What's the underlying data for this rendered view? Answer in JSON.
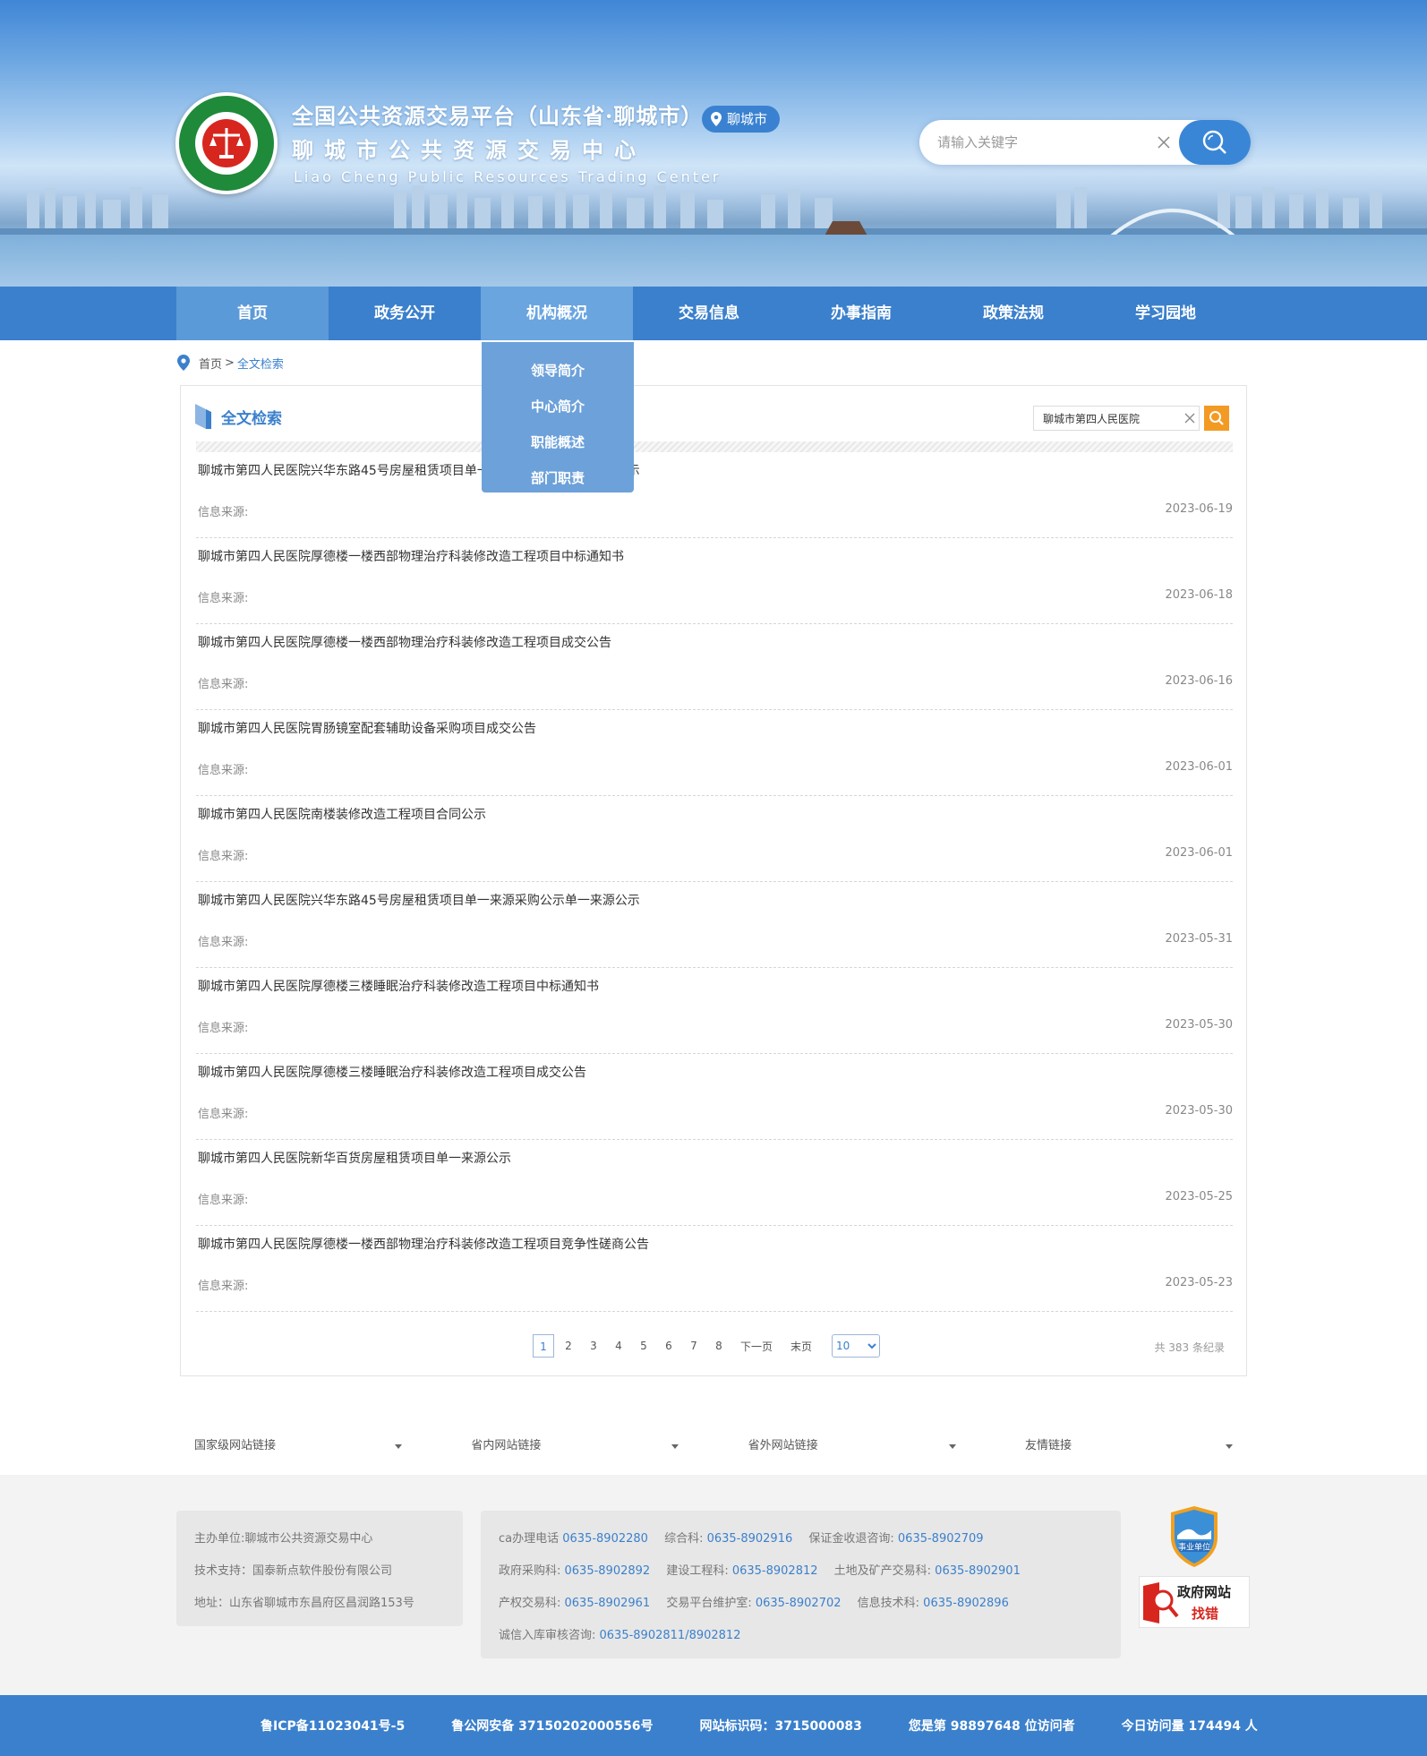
{
  "header": {
    "title_line1": "全国公共资源交易平台（山东省·聊城市）",
    "title_line2": "聊城市公共资源交易中心",
    "title_line3": "Liao Cheng Public Resources Trading Center",
    "city_badge": "聊城市",
    "search_placeholder": "请输入关键字"
  },
  "nav": {
    "items": [
      {
        "label": "首页"
      },
      {
        "label": "政务公开"
      },
      {
        "label": "机构概况"
      },
      {
        "label": "交易信息"
      },
      {
        "label": "办事指南"
      },
      {
        "label": "政策法规"
      },
      {
        "label": "学习园地"
      }
    ],
    "dropdown": [
      "领导简介",
      "中心简介",
      "职能概述",
      "部门职责"
    ]
  },
  "breadcrumb": {
    "home": "首页",
    "separator": ">",
    "current": "全文检索"
  },
  "main": {
    "title": "全文检索",
    "search_value": "聊城市第四人民医院",
    "results": [
      {
        "title": "聊城市第四人民医院兴华东路45号房屋租赁项目单一来源采购公示单一来源公示",
        "source": "信息来源:",
        "date": "2023-06-19"
      },
      {
        "title": "聊城市第四人民医院厚德楼一楼西部物理治疗科装修改造工程项目中标通知书",
        "source": "信息来源:",
        "date": "2023-06-18"
      },
      {
        "title": "聊城市第四人民医院厚德楼一楼西部物理治疗科装修改造工程项目成交公告",
        "source": "信息来源:",
        "date": "2023-06-16"
      },
      {
        "title": "聊城市第四人民医院胃肠镜室配套辅助设备采购项目成交公告",
        "source": "信息来源:",
        "date": "2023-06-01"
      },
      {
        "title": "聊城市第四人民医院南楼装修改造工程项目合同公示",
        "source": "信息来源:",
        "date": "2023-06-01"
      },
      {
        "title": "聊城市第四人民医院兴华东路45号房屋租赁项目单一来源采购公示单一来源公示",
        "source": "信息来源:",
        "date": "2023-05-31"
      },
      {
        "title": "聊城市第四人民医院厚德楼三楼睡眠治疗科装修改造工程项目中标通知书",
        "source": "信息来源:",
        "date": "2023-05-30"
      },
      {
        "title": "聊城市第四人民医院厚德楼三楼睡眠治疗科装修改造工程项目成交公告",
        "source": "信息来源:",
        "date": "2023-05-30"
      },
      {
        "title": "聊城市第四人民医院新华百货房屋租赁项目单一来源公示",
        "source": "信息来源:",
        "date": "2023-05-25"
      },
      {
        "title": "聊城市第四人民医院厚德楼一楼西部物理治疗科装修改造工程项目竞争性磋商公告",
        "source": "信息来源:",
        "date": "2023-05-23"
      }
    ],
    "pager": {
      "pages": [
        "1",
        "2",
        "3",
        "4",
        "5",
        "6",
        "7",
        "8"
      ],
      "current_page": "1",
      "next": "下一页",
      "last": "末页",
      "page_size": "10",
      "total": "共 383 条纪录"
    }
  },
  "links": [
    "国家级网站链接",
    "省内网站链接",
    "省外网站链接",
    "友情链接"
  ],
  "footer": {
    "left_lines": [
      "主办单位:聊城市公共资源交易中心",
      "技术支持：国泰新点软件股份有限公司",
      "地址：山东省聊城市东昌府区昌润路153号"
    ],
    "contacts": [
      [
        {
          "label": "ca办理电话 ",
          "number": "0635-8902280"
        },
        {
          "label": "综合科: ",
          "number": "0635-8902916"
        },
        {
          "label": "保证金收退咨询: ",
          "number": "0635-8902709"
        }
      ],
      [
        {
          "label": "政府采购科: ",
          "number": "0635-8902892"
        },
        {
          "label": "建设工程科: ",
          "number": "0635-8902812"
        },
        {
          "label": "土地及矿产交易科: ",
          "number": "0635-8902901"
        }
      ],
      [
        {
          "label": "产权交易科: ",
          "number": "0635-8902961"
        },
        {
          "label": "交易平台维护室: ",
          "number": "0635-8902702"
        },
        {
          "label": "信息技术科: ",
          "number": "0635-8902896"
        }
      ],
      [
        {
          "label": "诚信入库审核咨询: ",
          "number": "0635-8902811/8902812"
        }
      ]
    ],
    "badge_text": "事业单位",
    "zhaocuo_line1": "政府网站",
    "zhaocuo_line2": "找错"
  },
  "bottom": {
    "icp": "鲁ICP备11023041号-5",
    "police": "鲁公网安备 37150202000556号",
    "site_id": "网站标识码：3715000083",
    "visitor": "您是第 98897648 位访问者",
    "today": "今日访问量 174494 人"
  },
  "colors": {
    "primary": "#3b80cc",
    "search_button": "#f39a24",
    "logo_green": "#1f8a3a",
    "logo_red": "#d7261e"
  }
}
